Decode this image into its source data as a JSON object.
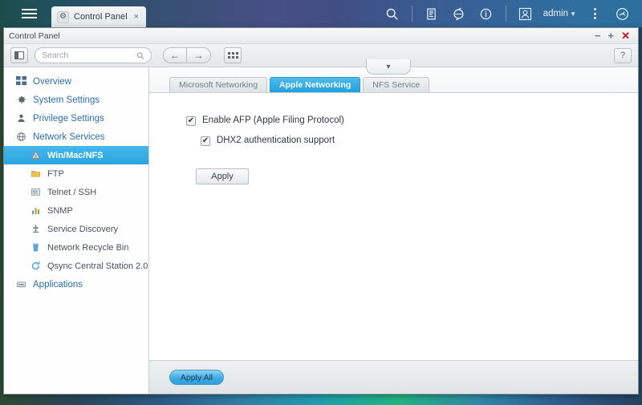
{
  "topbar": {
    "menu_icon": "hamburger-icon",
    "app_tab": {
      "label": "Control Panel",
      "icon": "gear-icon",
      "close": "×"
    },
    "icons": [
      {
        "name": "search-icon"
      },
      {
        "name": "notes-icon"
      },
      {
        "name": "sync-icon"
      },
      {
        "name": "info-icon"
      }
    ],
    "user": {
      "avatar_icon": "user-avatar-icon",
      "name": "admin",
      "caret": "▼"
    },
    "kebab_icon": "more-options-icon",
    "dashboard_icon": "resource-monitor-icon"
  },
  "window": {
    "title": "Control Panel",
    "controls": {
      "minimize": "−",
      "maximize": "+",
      "close": "✕"
    },
    "help_label": "?"
  },
  "toolbar": {
    "panel_toggle_icon": "sidebar-toggle-icon",
    "search": {
      "placeholder": "Search",
      "value": "",
      "icon": "search-icon"
    },
    "back_label": "←",
    "forward_label": "→",
    "apps_grid_icon": "apps-grid-icon"
  },
  "sidebar": {
    "items": [
      {
        "label": "Overview",
        "icon": "grid-icon",
        "level": "top",
        "selected": false
      },
      {
        "label": "System Settings",
        "icon": "gear-icon",
        "level": "top",
        "selected": false
      },
      {
        "label": "Privilege Settings",
        "icon": "user-icon",
        "level": "top",
        "selected": false
      },
      {
        "label": "Network Services",
        "icon": "globe-icon",
        "level": "top",
        "selected": false
      },
      {
        "label": "Win/Mac/NFS",
        "icon": "network-share-icon",
        "level": "sub",
        "selected": true
      },
      {
        "label": "FTP",
        "icon": "folder-icon",
        "level": "sub",
        "selected": false
      },
      {
        "label": "Telnet / SSH",
        "icon": "terminal-icon",
        "level": "sub",
        "selected": false
      },
      {
        "label": "SNMP",
        "icon": "bar-chart-icon",
        "level": "sub",
        "selected": false
      },
      {
        "label": "Service Discovery",
        "icon": "antenna-icon",
        "level": "sub",
        "selected": false
      },
      {
        "label": "Network Recycle Bin",
        "icon": "recycle-bin-icon",
        "level": "sub",
        "selected": false
      },
      {
        "label": "Qsync Central Station 2.0",
        "icon": "sync-circle-icon",
        "level": "sub",
        "selected": false
      },
      {
        "label": "Applications",
        "icon": "applications-icon",
        "level": "top",
        "selected": false
      }
    ]
  },
  "content": {
    "collapse_handle_icon": "chevron-down-icon",
    "tabs": [
      {
        "label": "Microsoft Networking",
        "active": false
      },
      {
        "label": "Apple Networking",
        "active": true
      },
      {
        "label": "NFS Service",
        "active": false
      }
    ],
    "options": [
      {
        "label": "Enable AFP (Apple Filing Protocol)",
        "checked": true,
        "indent": false
      },
      {
        "label": "DHX2 authentication support",
        "checked": true,
        "indent": true
      }
    ],
    "check_mark": "✔",
    "apply_label": "Apply"
  },
  "footer": {
    "apply_all_label": "Apply All"
  },
  "colors": {
    "accent_blue": "#29a4e0",
    "tab_active": "#22a0de",
    "close_red": "#d0121b",
    "sidebar_link": "#2c6fa8"
  }
}
